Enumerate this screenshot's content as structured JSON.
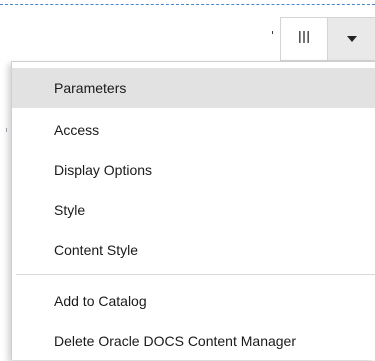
{
  "toolbar": {
    "columns_icon": "columns-icon",
    "dropdown_icon": "caret-down-icon"
  },
  "menu": {
    "items": [
      {
        "label": "Parameters",
        "highlighted": true
      },
      {
        "label": "Access"
      },
      {
        "label": "Display Options"
      },
      {
        "label": "Style"
      },
      {
        "label": "Content Style"
      },
      {
        "label": "Add to Catalog"
      },
      {
        "label": "Delete Oracle DOCS Content Manager"
      }
    ]
  },
  "colors": {
    "dashed_border": "#4a86c8",
    "highlight": "#e2e2e2",
    "text": "#1a1a1a"
  }
}
